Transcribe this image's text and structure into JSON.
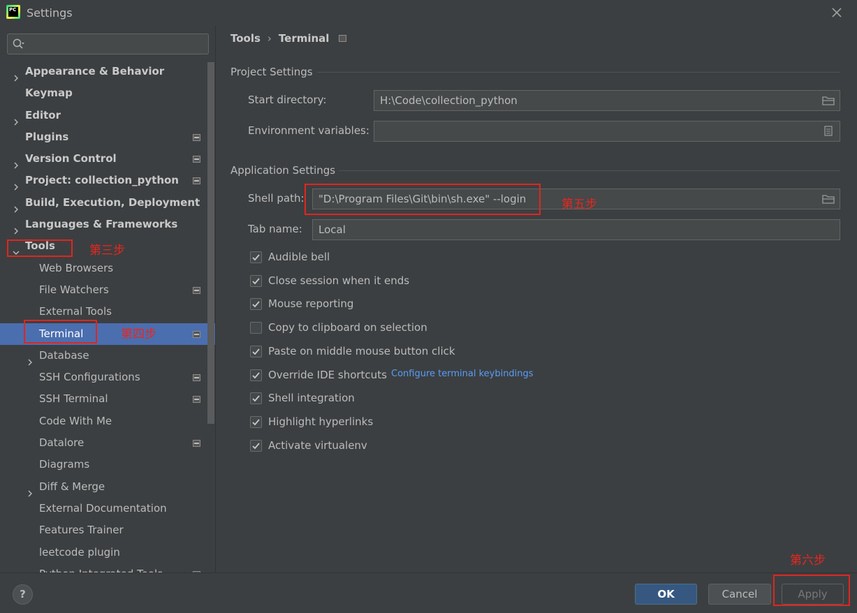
{
  "window": {
    "title": "Settings",
    "app_icon_text": "PC"
  },
  "search": {
    "placeholder": ""
  },
  "sidebar": {
    "items": [
      {
        "label": "Appearance & Behavior",
        "bold": true,
        "arrow": "right",
        "indent": 0,
        "project_icon": false
      },
      {
        "label": "Keymap",
        "bold": true,
        "arrow": "none",
        "indent": 0,
        "project_icon": false
      },
      {
        "label": "Editor",
        "bold": true,
        "arrow": "right",
        "indent": 0,
        "project_icon": false
      },
      {
        "label": "Plugins",
        "bold": true,
        "arrow": "none",
        "indent": 0,
        "project_icon": true
      },
      {
        "label": "Version Control",
        "bold": true,
        "arrow": "right",
        "indent": 0,
        "project_icon": true
      },
      {
        "label": "Project: collection_python",
        "bold": true,
        "arrow": "right",
        "indent": 0,
        "project_icon": true
      },
      {
        "label": "Build, Execution, Deployment",
        "bold": true,
        "arrow": "right",
        "indent": 0,
        "project_icon": false
      },
      {
        "label": "Languages & Frameworks",
        "bold": true,
        "arrow": "right",
        "indent": 0,
        "project_icon": false
      },
      {
        "label": "Tools",
        "bold": true,
        "arrow": "down",
        "indent": 0,
        "project_icon": false
      },
      {
        "label": "Web Browsers",
        "bold": false,
        "arrow": "none",
        "indent": 1,
        "project_icon": false
      },
      {
        "label": "File Watchers",
        "bold": false,
        "arrow": "none",
        "indent": 1,
        "project_icon": true
      },
      {
        "label": "External Tools",
        "bold": false,
        "arrow": "none",
        "indent": 1,
        "project_icon": false
      },
      {
        "label": "Terminal",
        "bold": false,
        "arrow": "none",
        "indent": 1,
        "project_icon": true,
        "selected": true
      },
      {
        "label": "Database",
        "bold": false,
        "arrow": "right",
        "indent": 1,
        "project_icon": false
      },
      {
        "label": "SSH Configurations",
        "bold": false,
        "arrow": "none",
        "indent": 1,
        "project_icon": true
      },
      {
        "label": "SSH Terminal",
        "bold": false,
        "arrow": "none",
        "indent": 1,
        "project_icon": true
      },
      {
        "label": "Code With Me",
        "bold": false,
        "arrow": "none",
        "indent": 1,
        "project_icon": false
      },
      {
        "label": "Datalore",
        "bold": false,
        "arrow": "none",
        "indent": 1,
        "project_icon": true
      },
      {
        "label": "Diagrams",
        "bold": false,
        "arrow": "none",
        "indent": 1,
        "project_icon": false
      },
      {
        "label": "Diff & Merge",
        "bold": false,
        "arrow": "right",
        "indent": 1,
        "project_icon": false
      },
      {
        "label": "External Documentation",
        "bold": false,
        "arrow": "none",
        "indent": 1,
        "project_icon": false
      },
      {
        "label": "Features Trainer",
        "bold": false,
        "arrow": "none",
        "indent": 1,
        "project_icon": false
      },
      {
        "label": "leetcode plugin",
        "bold": false,
        "arrow": "none",
        "indent": 1,
        "project_icon": false
      },
      {
        "label": "Python Integrated Tools",
        "bold": false,
        "arrow": "none",
        "indent": 1,
        "project_icon": true
      }
    ]
  },
  "breadcrumb": {
    "parent": "Tools",
    "separator": "›",
    "current": "Terminal"
  },
  "project_settings": {
    "title": "Project Settings",
    "start_directory_label": "Start directory:",
    "start_directory_value": "H:\\Code\\collection_python",
    "env_vars_label": "Environment variables:",
    "env_vars_value": ""
  },
  "application_settings": {
    "title": "Application Settings",
    "shell_path_label": "Shell path:",
    "shell_path_value": "\"D:\\Program Files\\Git\\bin\\sh.exe\"  --login",
    "tab_name_label": "Tab name:",
    "tab_name_value": "Local",
    "checkboxes": [
      {
        "label": "Audible bell",
        "checked": true
      },
      {
        "label": "Close session when it ends",
        "checked": true
      },
      {
        "label": "Mouse reporting",
        "checked": true
      },
      {
        "label": "Copy to clipboard on selection",
        "checked": false
      },
      {
        "label": "Paste on middle mouse button click",
        "checked": true
      },
      {
        "label": "Override IDE shortcuts",
        "checked": true
      },
      {
        "label": "Shell integration",
        "checked": true
      },
      {
        "label": "Highlight hyperlinks",
        "checked": true
      },
      {
        "label": "Activate virtualenv",
        "checked": true
      }
    ],
    "keybindings_link": "Configure terminal keybindings"
  },
  "annotations": {
    "step3": "第三步",
    "step4": "第四步",
    "step5": "第五步",
    "step6": "第六步",
    "color": "#e0261f"
  },
  "footer": {
    "help_label": "?",
    "ok_label": "OK",
    "cancel_label": "Cancel",
    "apply_label": "Apply"
  },
  "colors": {
    "background": "#3c3f41",
    "selection": "#4b6eaf",
    "ok_button": "#365880",
    "link": "#589df6"
  }
}
